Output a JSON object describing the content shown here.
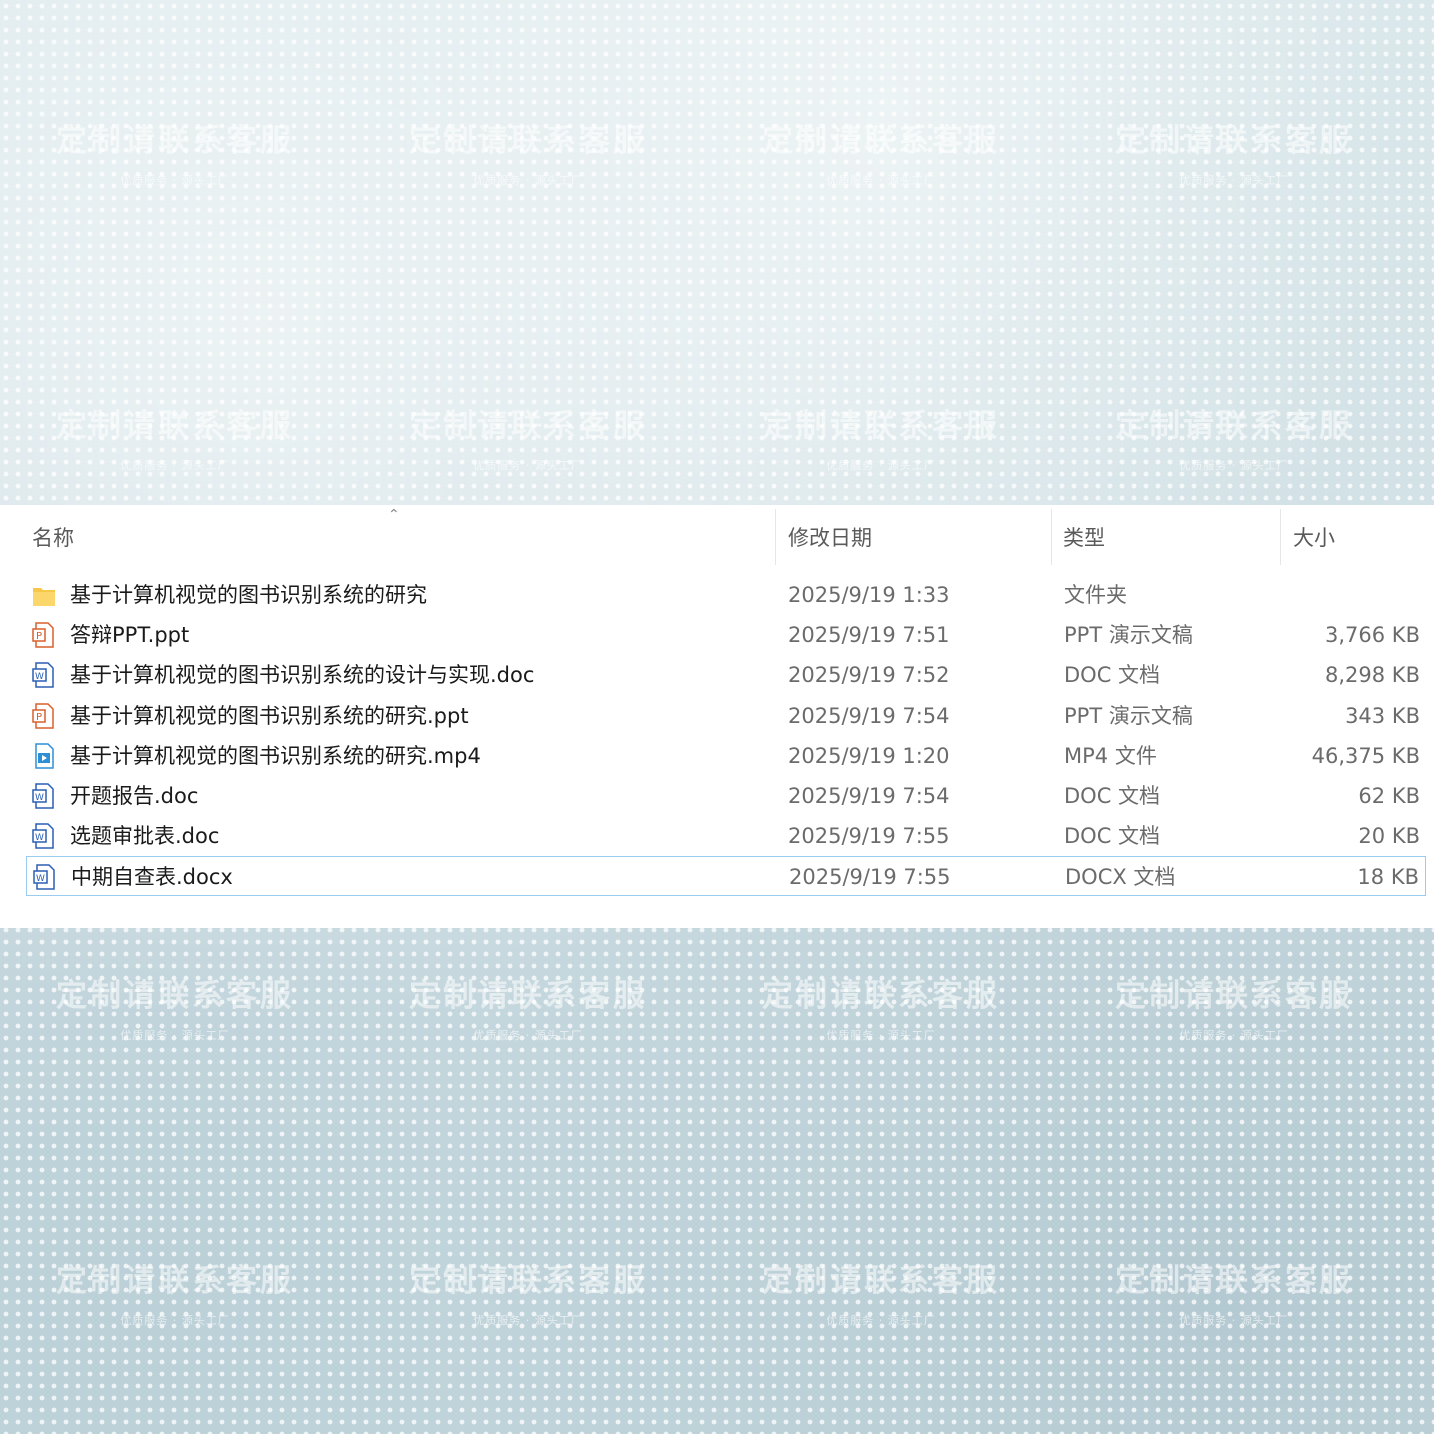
{
  "watermark": {
    "main": "定制请联系客服",
    "sub": "优质服务 · 源头工厂"
  },
  "explorer": {
    "columns": {
      "name": "名称",
      "modified": "修改日期",
      "type": "类型",
      "size": "大小"
    },
    "files": [
      {
        "icon": "folder-icon",
        "name": "基于计算机视觉的图书识别系统的研究",
        "modified": "2025/9/19 1:33",
        "type": "文件夹",
        "size": ""
      },
      {
        "icon": "ppt-file-icon",
        "name": "答辩PPT.ppt",
        "modified": "2025/9/19 7:51",
        "type": "PPT 演示文稿",
        "size": "3,766 KB"
      },
      {
        "icon": "word-file-icon",
        "name": "基于计算机视觉的图书识别系统的设计与实现.doc",
        "modified": "2025/9/19 7:52",
        "type": "DOC 文档",
        "size": "8,298 KB"
      },
      {
        "icon": "ppt-file-icon",
        "name": "基于计算机视觉的图书识别系统的研究.ppt",
        "modified": "2025/9/19 7:54",
        "type": "PPT 演示文稿",
        "size": "343 KB"
      },
      {
        "icon": "video-file-icon",
        "name": "基于计算机视觉的图书识别系统的研究.mp4",
        "modified": "2025/9/19 1:20",
        "type": "MP4 文件",
        "size": "46,375 KB"
      },
      {
        "icon": "word-file-icon",
        "name": "开题报告.doc",
        "modified": "2025/9/19 7:54",
        "type": "DOC 文档",
        "size": "62 KB"
      },
      {
        "icon": "word-file-icon",
        "name": "选题审批表.doc",
        "modified": "2025/9/19 7:55",
        "type": "DOC 文档",
        "size": "20 KB"
      },
      {
        "icon": "word-file-icon",
        "name": "中期自查表.docx",
        "modified": "2025/9/19 7:55",
        "type": "DOCX 文档",
        "size": "18 KB",
        "selected": true
      }
    ]
  },
  "colors": {
    "selection_border": "#99ccee",
    "folder": "#f5c84a",
    "ppt": "#d9602b",
    "word": "#2b5fb4",
    "video": "#2f8fd6"
  }
}
